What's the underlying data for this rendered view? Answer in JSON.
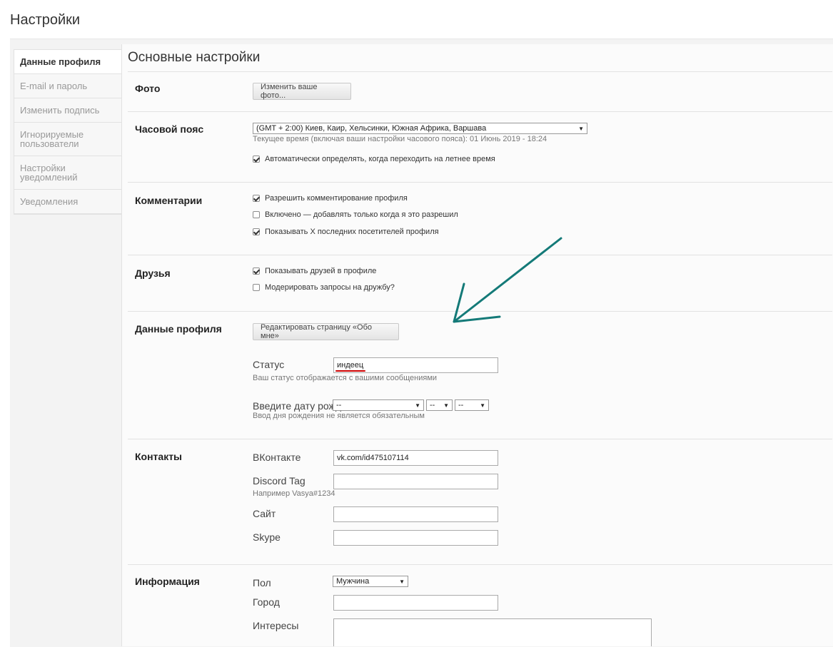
{
  "page": {
    "title": "Настройки"
  },
  "sidebar": {
    "items": [
      {
        "label": "Данные профиля",
        "active": true
      },
      {
        "label": "E-mail и пароль"
      },
      {
        "label": "Изменить подпись"
      },
      {
        "label": "Игнорируемые пользователи"
      },
      {
        "label": "Настройки уведомлений"
      },
      {
        "label": "Уведомления"
      }
    ]
  },
  "main": {
    "title": "Основные настройки",
    "photo": {
      "label": "Фото",
      "button": "Изменить ваше фото..."
    },
    "timezone": {
      "label": "Часовой пояс",
      "selected": "(GMT + 2:00) Киев, Каир, Хельсинки, Южная Африка, Варшава",
      "hint": "Текущее время (включая ваши настройки часового пояса): 01 Июнь 2019 - 18:24",
      "dst_label": "Автоматически определять, когда переходить на летнее время",
      "dst_checked": true
    },
    "comments": {
      "label": "Комментарии",
      "options": [
        {
          "label": "Разрешить комментирование профиля",
          "checked": true
        },
        {
          "label": "Включено — добавлять только когда я это разрешил",
          "checked": false
        },
        {
          "label": "Показывать X последних посетителей профиля",
          "checked": true
        }
      ]
    },
    "friends": {
      "label": "Друзья",
      "options": [
        {
          "label": "Показывать друзей в профиле",
          "checked": true
        },
        {
          "label": "Модерировать запросы на дружбу?",
          "checked": false
        }
      ]
    },
    "profile_data": {
      "label": "Данные профиля",
      "button": "Редактировать страницу «Обо мне»",
      "status_label": "Статус",
      "status_value": "индеец",
      "status_hint": "Ваш статус отображается с вашими сообщениями",
      "birthday_label": "Введите дату рождения",
      "birthday_day": "--",
      "birthday_month": "--",
      "birthday_year": "--",
      "birthday_hint": "Ввод дня рождения не является обязательным"
    },
    "contacts": {
      "label": "Контакты",
      "vk_label": "ВКонтакте",
      "vk_value": "vk.com/id475107114",
      "discord_label": "Discord Tag",
      "discord_value": "",
      "discord_hint": "Например Vasya#1234",
      "site_label": "Сайт",
      "site_value": "",
      "skype_label": "Skype",
      "skype_value": ""
    },
    "info": {
      "label": "Информация",
      "gender_label": "Пол",
      "gender_value": "Мужчина",
      "city_label": "Город",
      "city_value": "",
      "interests_label": "Интересы",
      "interests_value": ""
    }
  },
  "colors": {
    "annotation_arrow": "#147a78",
    "underline": "#cc0000"
  }
}
